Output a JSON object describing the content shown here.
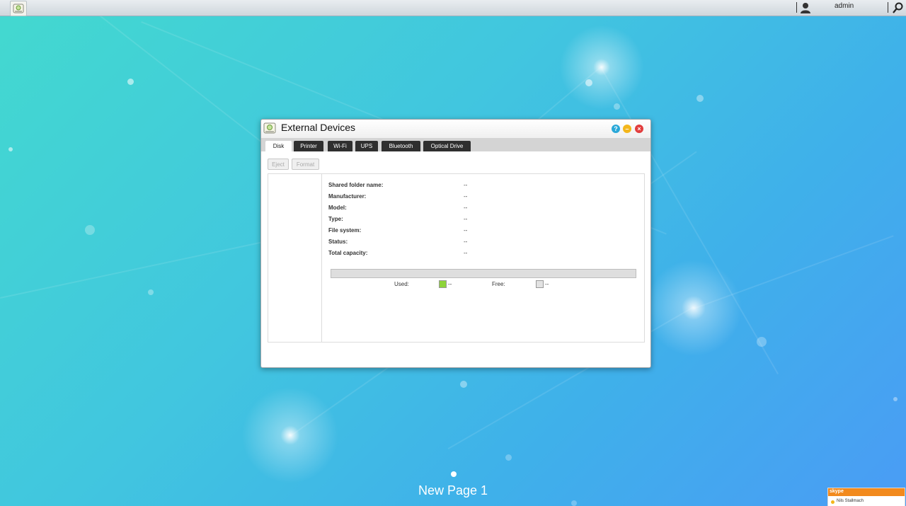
{
  "topbar": {
    "user_name": "admin"
  },
  "window": {
    "title": "External Devices",
    "controls": {
      "help": "?",
      "minimize": "–",
      "close": "×"
    },
    "tabs": [
      {
        "label": "Disk",
        "active": true
      },
      {
        "label": "Printer",
        "active": false
      },
      {
        "label": "Wi-Fi",
        "active": false
      },
      {
        "label": "UPS",
        "active": false
      },
      {
        "label": "Bluetooth",
        "active": false
      },
      {
        "label": "Optical Drive",
        "active": false
      }
    ],
    "actions": {
      "eject": "Eject",
      "format": "Format"
    },
    "details": [
      {
        "label": "Shared folder name:",
        "value": "--"
      },
      {
        "label": "Manufacturer:",
        "value": "--"
      },
      {
        "label": "Model:",
        "value": "--"
      },
      {
        "label": "Type:",
        "value": "--"
      },
      {
        "label": "File system:",
        "value": "--"
      },
      {
        "label": "Status:",
        "value": "--"
      },
      {
        "label": "Total capacity:",
        "value": "--"
      }
    ],
    "capacity": {
      "used_label": "Used:",
      "used_value": "--",
      "free_label": "Free:",
      "free_value": "--"
    }
  },
  "desktop": {
    "page_label": "New Page 1"
  },
  "chat_widget": {
    "brand": "skype",
    "contact": "Nils Stallmach"
  },
  "colors": {
    "accent": "#2aa8d8",
    "used_swatch": "#8ed43a",
    "free_swatch": "#e2e2e2",
    "close_button": "#e23d3d",
    "minimize_button": "#f3b61b"
  }
}
